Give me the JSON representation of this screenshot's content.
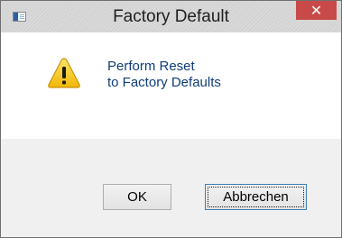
{
  "window": {
    "title": "Factory Default",
    "close_glyph": "✕",
    "app_icon": "window-app-icon"
  },
  "dialog": {
    "icon": "warning-icon",
    "message_line1": "Perform Reset",
    "message_line2": "to Factory Defaults"
  },
  "buttons": {
    "ok_label": "OK",
    "cancel_label": "Abbrechen"
  },
  "colors": {
    "close_button": "#c84a48",
    "message_text": "#0f3d7a",
    "warning_fill": "#f7c51c",
    "focused_button_border": "#3c7fb1"
  }
}
